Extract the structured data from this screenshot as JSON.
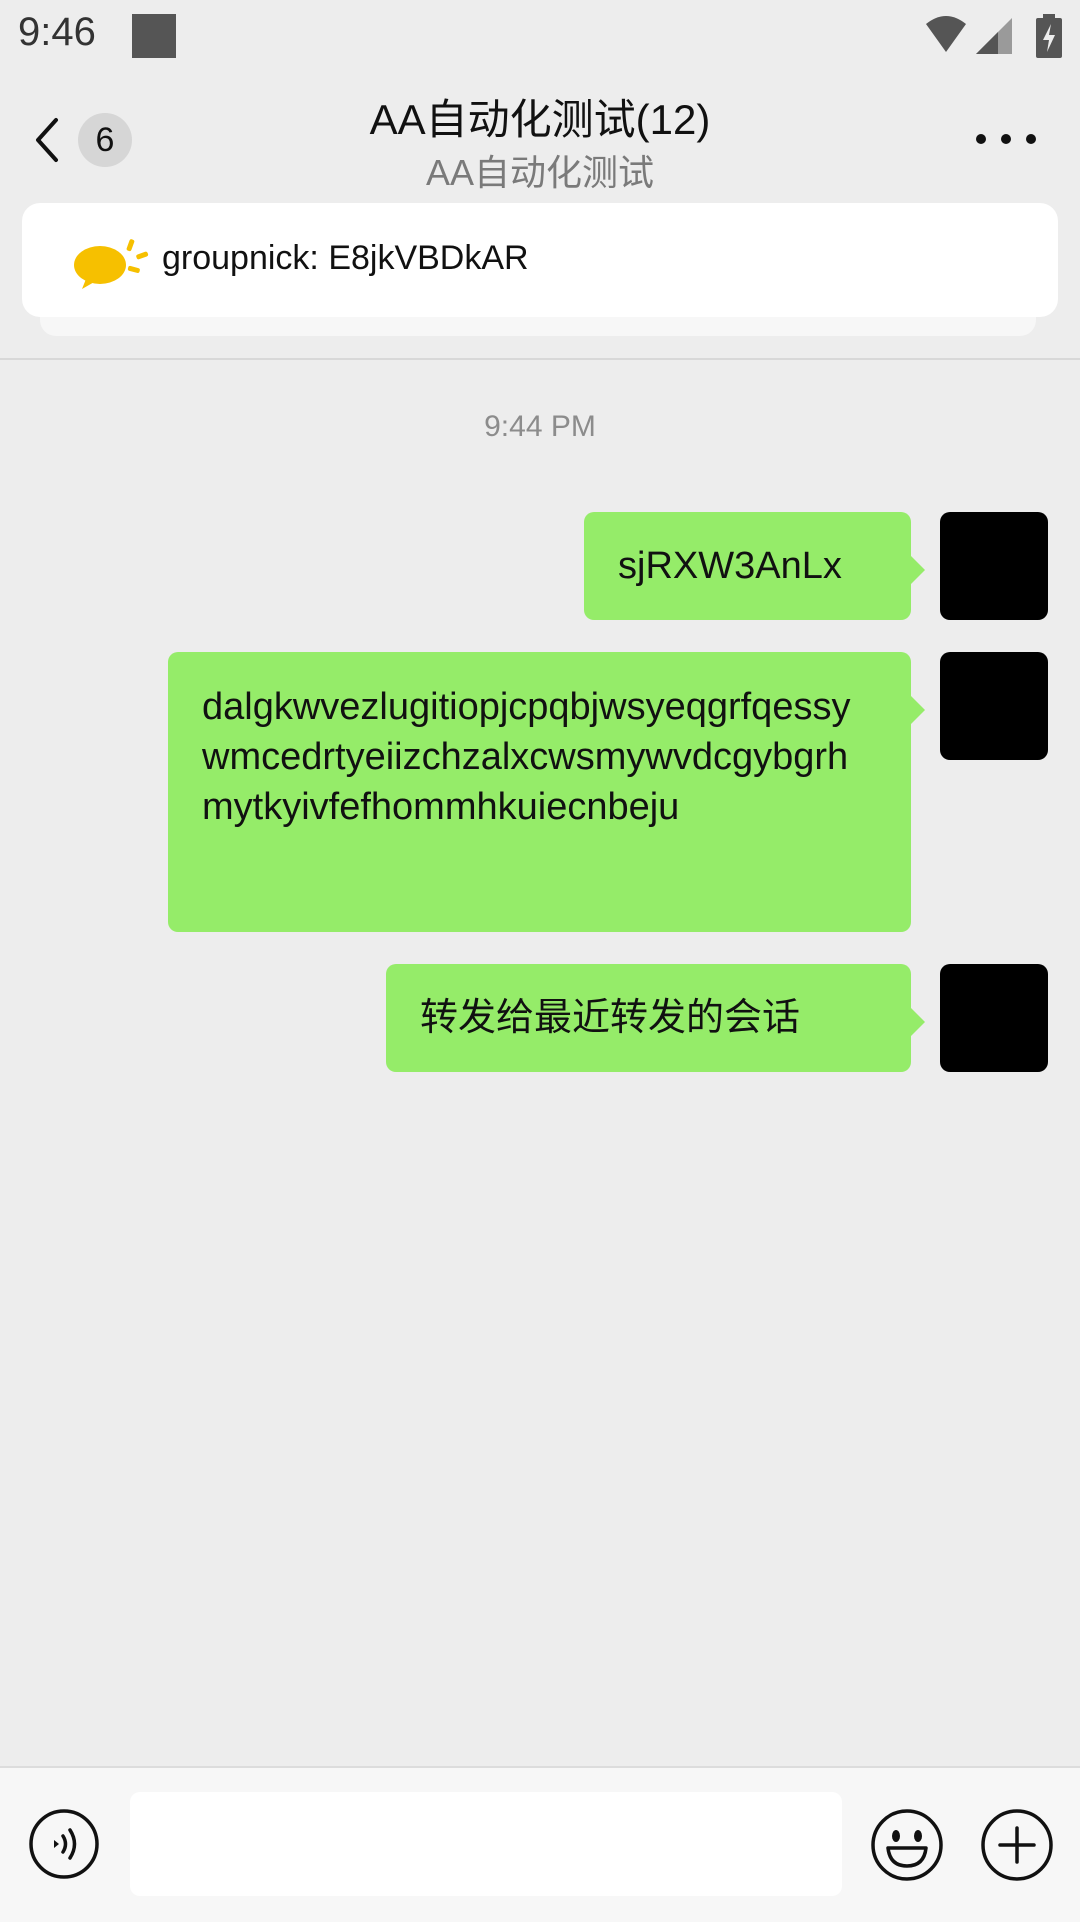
{
  "status_bar": {
    "time": "9:46"
  },
  "header": {
    "unread_count": "6",
    "title": "AA自动化测试(12)",
    "subtitle": "AA自动化测试"
  },
  "notice": {
    "text": "groupnick: E8jkVBDkAR"
  },
  "chat": {
    "timestamp": "9:44 PM",
    "messages": [
      {
        "text": "sjRXW3AnLx"
      },
      {
        "text": "dalgkwvezlugitiopjcpqbjwsyeqgrfqessywmcedrtyeiizchzalxcwsmywvdcgybgrhmytkyivfefhommhkuiecnbeju"
      },
      {
        "text": "转发给最近转发的会话"
      }
    ]
  },
  "colors": {
    "background": "#ededed",
    "bubble_sent": "#95ec69",
    "notice_icon": "#f6c000"
  }
}
